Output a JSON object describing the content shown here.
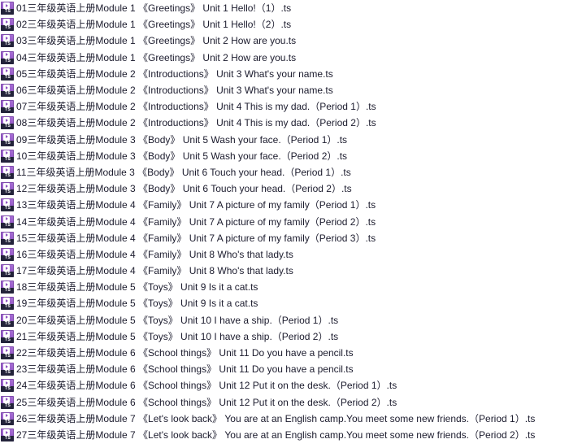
{
  "window": {
    "view": "file-list",
    "background_color": "#ffffff",
    "text_color": "#1b1b2d",
    "icon_color": "#9a5fcb",
    "icon_badge_color": "#23233a"
  },
  "icon": {
    "name": "ts-video-file-icon",
    "badge_label": "TS"
  },
  "files": [
    {
      "name": "01三年级英语上册Module 1 《Greetings》 Unit 1 Hello!（1）.ts"
    },
    {
      "name": "02三年级英语上册Module 1 《Greetings》 Unit 1 Hello!（2）.ts"
    },
    {
      "name": "03三年级英语上册Module 1 《Greetings》 Unit 2 How are you.ts"
    },
    {
      "name": "04三年级英语上册Module 1 《Greetings》 Unit 2 How are you.ts"
    },
    {
      "name": "05三年级英语上册Module 2 《Introductions》 Unit 3 What's your name.ts"
    },
    {
      "name": "06三年级英语上册Module 2 《Introductions》 Unit 3 What's your name.ts"
    },
    {
      "name": "07三年级英语上册Module 2 《Introductions》 Unit 4 This is my dad.（Period 1）.ts"
    },
    {
      "name": "08三年级英语上册Module 2 《Introductions》 Unit 4 This is my dad.（Period 2）.ts"
    },
    {
      "name": "09三年级英语上册Module 3 《Body》 Unit 5 Wash your face.（Period 1）.ts"
    },
    {
      "name": "10三年级英语上册Module 3 《Body》 Unit 5 Wash your face.（Period 2）.ts"
    },
    {
      "name": "11三年级英语上册Module 3 《Body》 Unit 6 Touch your head.（Period 1）.ts"
    },
    {
      "name": "12三年级英语上册Module 3 《Body》 Unit 6 Touch your head.（Period 2）.ts"
    },
    {
      "name": "13三年级英语上册Module 4 《Family》 Unit 7 A picture of my family（Period 1）.ts"
    },
    {
      "name": "14三年级英语上册Module 4 《Family》 Unit 7 A picture of my family（Period 2）.ts"
    },
    {
      "name": "15三年级英语上册Module 4 《Family》 Unit 7 A picture of my family（Period 3）.ts"
    },
    {
      "name": "16三年级英语上册Module 4 《Family》 Unit 8 Who's that lady.ts"
    },
    {
      "name": "17三年级英语上册Module 4 《Family》 Unit 8 Who's that lady.ts"
    },
    {
      "name": "18三年级英语上册Module 5 《Toys》 Unit 9 Is it a cat.ts"
    },
    {
      "name": "19三年级英语上册Module 5 《Toys》 Unit 9 Is it a cat.ts"
    },
    {
      "name": "20三年级英语上册Module 5 《Toys》 Unit 10 I have a ship.（Period 1）.ts"
    },
    {
      "name": "21三年级英语上册Module 5 《Toys》 Unit 10 I have a ship.（Period 2）.ts"
    },
    {
      "name": "22三年级英语上册Module 6 《School things》 Unit 11 Do you have a pencil.ts"
    },
    {
      "name": "23三年级英语上册Module 6 《School things》 Unit 11 Do you have a pencil.ts"
    },
    {
      "name": "24三年级英语上册Module 6 《School things》 Unit 12 Put it on the desk.（Period 1）.ts"
    },
    {
      "name": "25三年级英语上册Module 6 《School things》 Unit 12 Put it on the desk.（Period 2）.ts"
    },
    {
      "name": "26三年级英语上册Module 7 《Let's look back》 You are at an English camp.You meet some new friends.（Period 1）.ts"
    },
    {
      "name": "27三年级英语上册Module 7 《Let's look back》 You are at an English camp.You meet some new friends.（Period 2）.ts"
    }
  ]
}
